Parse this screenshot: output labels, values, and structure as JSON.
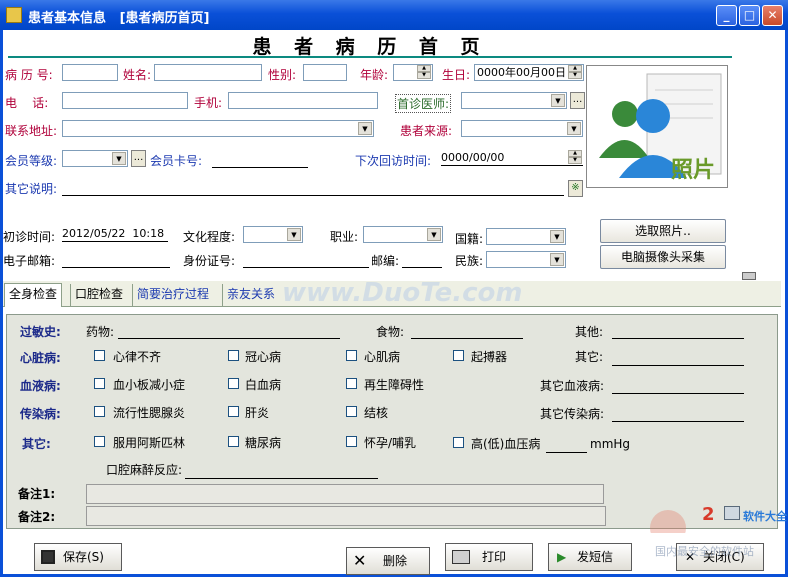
{
  "window": {
    "title": "患者基本信息   [患者病历首页]",
    "minimize": "_",
    "maximize": "□",
    "close": "✕"
  },
  "heading": "患 者 病 历 首 页",
  "form": {
    "record_no_label": "病 历 号:",
    "name_label": "姓名:",
    "gender_label": "性别:",
    "age_label": "年龄:",
    "birth_label": "生日:",
    "birth_value": "0000年00月00日",
    "phone_label": "电    话:",
    "mobile_label": "手机:",
    "first_doctor_label": "首诊医师:",
    "address_label": "联系地址:",
    "source_label": "患者来源:",
    "member_level_label": "会员等级:",
    "member_card_label": "会员卡号:",
    "next_visit_label": "下次回访时间:",
    "next_visit_value": "0000/00/00",
    "other_label": "其它说明:",
    "first_visit_label": "初诊时间:",
    "first_visit_value": "2012/05/22  10:18",
    "education_label": "文化程度:",
    "occupation_label": "职业:",
    "nationality_label": "国籍:",
    "email_label": "电子邮箱:",
    "id_label": "身份证号:",
    "postcode_label": "邮编:",
    "ethnicity_label": "民族:",
    "photo_text": "照片",
    "choose_photo": "选取照片..",
    "camera": "电脑摄像头采集",
    "dots": "...",
    "note_btn": "※"
  },
  "tabs": [
    "全身检查",
    "口腔检查",
    "简要治疗过程",
    "亲友关系"
  ],
  "panel": {
    "allergy_label": "过敏史:",
    "drug_label": "药物:",
    "food_label": "食物:",
    "allergy_other_label": "其他:",
    "heart_label": "心脏病:",
    "heart_items": [
      "心律不齐",
      "冠心病",
      "心肌病",
      "起搏器"
    ],
    "heart_other_label": "其它:",
    "blood_label": "血液病:",
    "blood_items": [
      "血小板减小症",
      "白血病",
      "再生障碍性"
    ],
    "blood_other_label": "其它血液病:",
    "infect_label": "传染病:",
    "infect_items": [
      "流行性腮腺炎",
      "肝炎",
      "结核"
    ],
    "infect_other_label": "其它传染病:",
    "other_label": "其它:",
    "other_items": [
      "服用阿斯匹林",
      "糖尿病",
      "怀孕/哺乳",
      "高(低)血压病"
    ],
    "mmhg": "mmHg",
    "anesthesia_label": "口腔麻醉反应:",
    "note1_label": "备注1:",
    "note2_label": "备注2:"
  },
  "buttons": {
    "save": "保存(S)",
    "delete": "删除",
    "print": "打印",
    "sms": "发短信",
    "close": "关闭(C)"
  },
  "watermarks": {
    "duote": "www.DuoTe.com",
    "brand_a": "2",
    "brand_b": "软件大全",
    "brand_c": "国内最安全的软件站"
  },
  "colors": {
    "titlebar": "#0a50d8",
    "accent_rule": "#0c8a80",
    "panel_bg": "#e3e5dd"
  }
}
